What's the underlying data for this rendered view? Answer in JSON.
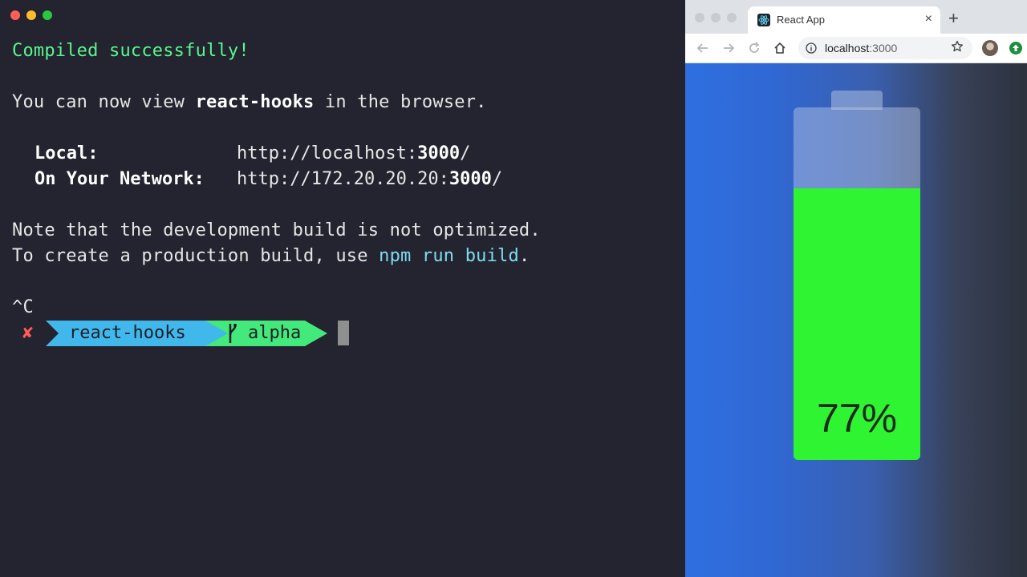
{
  "terminal": {
    "lines": {
      "compiled": "Compiled successfully!",
      "view_prefix": "You can now view ",
      "app_name": "react-hooks",
      "view_suffix": " in the browser.",
      "local_label": "Local:",
      "local_url_prefix": "http://localhost:",
      "local_port": "3000",
      "local_url_suffix": "/",
      "network_label": "On Your Network:",
      "network_url_prefix": "http://172.20.20.20:",
      "network_port": "3000",
      "network_url_suffix": "/",
      "note": "Note that the development build is not optimized.",
      "create_prefix": "To create a production build, use ",
      "create_cmd": "npm run build",
      "create_suffix": ".",
      "interrupt": "^C"
    },
    "prompt": {
      "status_mark": "✘",
      "directory": "react-hooks",
      "branch": "alpha"
    },
    "colors": {
      "background": "#23242f",
      "success": "#5af78e",
      "command": "#7fdcf0",
      "dir_segment": "#41b8ec",
      "branch_segment": "#43e97b",
      "error_mark": "#ff5c57"
    }
  },
  "browser": {
    "tab": {
      "title": "React App",
      "close": "×",
      "favicon": "react-icon"
    },
    "new_tab": "+",
    "url": {
      "host": "localhost",
      "port": ":3000"
    },
    "icons": [
      "back-icon",
      "forward-icon",
      "reload-icon",
      "home-icon",
      "info-icon",
      "star-icon",
      "avatar",
      "update-icon"
    ]
  },
  "app": {
    "battery": {
      "level": 0.77,
      "label": "77%",
      "fill_color": "#2ef432"
    }
  }
}
